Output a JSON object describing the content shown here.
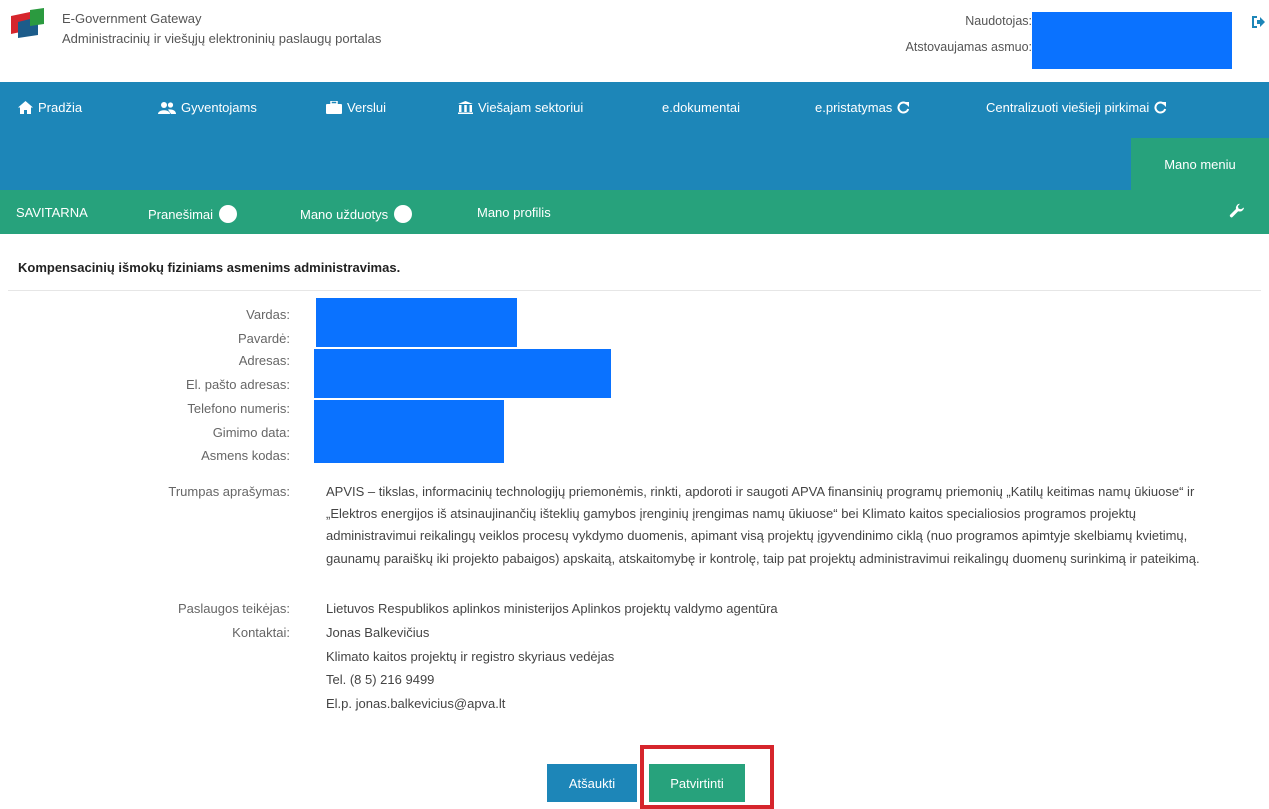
{
  "header": {
    "title": "E-Government Gateway",
    "subtitle": "Administracinių ir viešųjų elektroninių paslaugų portalas",
    "user_label": "Naudotojas:",
    "represented_label": "Atstovaujamas asmuo:"
  },
  "nav": {
    "items": [
      {
        "label": "Pradžia",
        "icon": "home-icon"
      },
      {
        "label": "Gyventojams",
        "icon": "users-icon"
      },
      {
        "label": "Verslui",
        "icon": "briefcase-icon"
      },
      {
        "label": "Viešajam sektoriui",
        "icon": "institution-icon"
      },
      {
        "label": "e.dokumentai"
      },
      {
        "label": "e.pristatymas",
        "icon": "external-link-icon"
      },
      {
        "label": "Centralizuoti viešieji pirkimai",
        "icon": "external-link-icon"
      }
    ],
    "mano_menu": "Mano meniu"
  },
  "subnav": {
    "items": [
      {
        "label": "SAVITARNA"
      },
      {
        "label": "Pranešimai"
      },
      {
        "label": "Mano užduotys"
      },
      {
        "label": "Mano profilis"
      }
    ]
  },
  "page": {
    "title": "Kompensacinių išmokų fiziniams asmenims administravimas."
  },
  "form": {
    "labels": {
      "vardas": "Vardas:",
      "pavarde": "Pavardė:",
      "adresas": "Adresas:",
      "el_pastas": "El. pašto adresas:",
      "telefonas": "Telefono numeris:",
      "gimimo_data": "Gimimo data:",
      "asmens_kodas": "Asmens kodas:",
      "aprasymas": "Trumpas aprašymas:",
      "teikejas": "Paslaugos teikėjas:",
      "kontaktai": "Kontaktai:"
    },
    "description": "APVIS – tikslas, informacinių technologijų priemonėmis, rinkti, apdoroti ir saugoti APVA finansinių programų priemonių „Katilų keitimas namų ūkiuose“ ir „Elektros energijos iš atsinaujinančių išteklių gamybos įrenginių įrengimas namų ūkiuose“ bei Klimato kaitos specialiosios programos projektų administravimui reikalingų veiklos procesų vykdymo duomenis, apimant visą projektų įgyvendinimo ciklą (nuo programos apimtyje skelbiamų kvietimų, gaunamų paraiškų iki projekto pabaigos) apskaitą, atskaitomybę ir kontrolę, taip pat projektų administravimui reikalingų duomenų surinkimą ir pateikimą.",
    "provider": "Lietuvos Respublikos aplinkos ministerijos Aplinkos projektų valdymo agentūra",
    "contact_name": "Jonas Balkevičius",
    "contact_position": "Klimato kaitos projektų ir registro skyriaus vedėjas",
    "contact_phone": "Tel. (8 5) 216 9499",
    "contact_email": "El.p. jonas.balkevicius@apva.lt"
  },
  "buttons": {
    "cancel": "Atšaukti",
    "confirm": "Patvirtinti"
  },
  "colors": {
    "nav_blue": "#1d86b8",
    "nav_green": "#27a27c",
    "redaction": "#0a72ff",
    "highlight": "#d6252c"
  }
}
